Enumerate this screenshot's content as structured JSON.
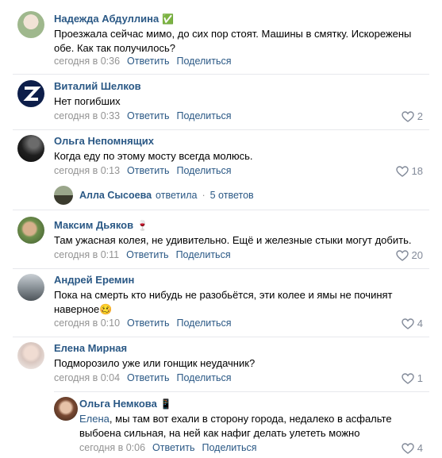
{
  "comments": [
    {
      "name": "Надежда Абдуллина",
      "badge": "✅",
      "text": "Проезжала сейчас мимо, до сих пор стоят. Машины в смятку. Искорежены обе. Как так получилось?",
      "time": "сегодня в 0:36",
      "reply_label": "Ответить",
      "share_label": "Поделиться",
      "likes": ""
    },
    {
      "name": "Виталий Шелков",
      "text": "Нет погибших",
      "time": "сегодня в 0:33",
      "reply_label": "Ответить",
      "share_label": "Поделиться",
      "likes": "2"
    },
    {
      "name": "Ольга Непомнящих",
      "text": "Когда еду по этому мосту всегда молюсь.",
      "time": "сегодня в 0:13",
      "reply_label": "Ответить",
      "share_label": "Поделиться",
      "likes": "18"
    },
    {
      "name": "Максим Дьяков",
      "badge": "🍷",
      "text": "Там ужасная колея, не удивительно. Ещё и железные стыки могут добить.",
      "time": "сегодня в 0:11",
      "reply_label": "Ответить",
      "share_label": "Поделиться",
      "likes": "20"
    },
    {
      "name": "Андрей Еремин",
      "text": "Пока на смерть кто нибудь не разобьётся, эти колее и ямы не починят наверное🥴",
      "time": "сегодня в 0:10",
      "reply_label": "Ответить",
      "share_label": "Поделиться",
      "likes": "4"
    },
    {
      "name": "Елена Мирная",
      "text": "Подморозило уже или гонщик неудачник?",
      "time": "сегодня в 0:04",
      "reply_label": "Ответить",
      "share_label": "Поделиться",
      "likes": "1"
    }
  ],
  "thread": {
    "name": "Алла Сысоева",
    "verb": "ответила",
    "dot": "·",
    "count": "5 ответов"
  },
  "reply": {
    "name": "Ольга Немкова",
    "badge": "📱",
    "mention": "Елена",
    "text": ", мы там вот ехали в сторону города, недалеко в асфальте выбоена сильная, на ней как нафиг делать улететь можно",
    "time": "сегодня в 0:06",
    "reply_label": "Ответить",
    "share_label": "Поделиться",
    "likes": "4"
  },
  "icons": {
    "like": "heart-outline-icon"
  },
  "colors": {
    "link": "#2a5885",
    "meta": "#939393",
    "separator": "#e7e8ec"
  }
}
